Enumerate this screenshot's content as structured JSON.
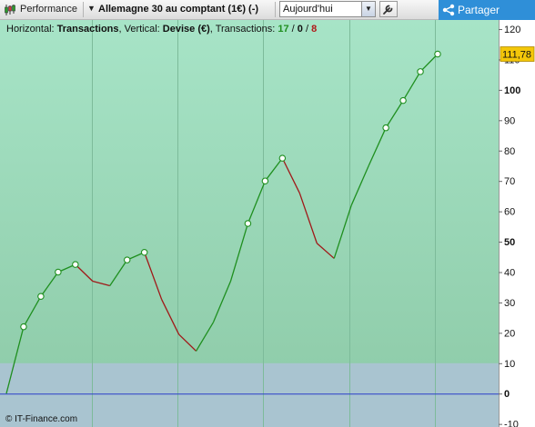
{
  "toolbar": {
    "performance_label": "Performance",
    "instrument_label": "Allemagne 30 au comptant (1€) (-)",
    "period_value": "Aujourd'hui",
    "share_label": "Partager",
    "icons": {
      "performance": "candlestick-chart-icon",
      "instrument_menu": "triangle-down-icon",
      "period": "chevron-down-icon",
      "settings": "wrench-icon",
      "share": "share-icon"
    }
  },
  "info": {
    "horizontal_prefix": "Horizontal: ",
    "horizontal_value": "Transactions",
    "vertical_prefix": ", Vertical: ",
    "vertical_value": "Devise (€)",
    "transactions_prefix": ", Transactions: ",
    "tx_win": "17",
    "tx_sep1": " / ",
    "tx_even": "0",
    "tx_sep2": " / ",
    "tx_loss": "8"
  },
  "credit": "© IT-Finance.com",
  "colors": {
    "profit_line": "#1f8f1f",
    "loss_line": "#a01818",
    "zero_line": "#2b3fc8",
    "bg_top": "#a7e4c7",
    "bg_bottom": "#8cc9a6",
    "below_band": "#a9c4d0",
    "last_value_badge": "#f3c70a",
    "tick_10_color": "#2e8b2e",
    "tick_neg10_color": "#cc2222"
  },
  "chart_data": {
    "type": "line",
    "xlabel": "Transactions",
    "ylabel": "Devise (€)",
    "ylim": [
      -11,
      123
    ],
    "x": [
      0,
      1,
      2,
      3,
      4,
      5,
      6,
      7,
      8,
      9,
      10,
      11,
      12,
      13,
      14,
      15,
      16,
      17,
      18,
      19,
      20,
      21,
      22,
      23,
      24,
      25
    ],
    "values": [
      0,
      22,
      32,
      40,
      42.5,
      37,
      35.5,
      44,
      46.5,
      31,
      19.5,
      14,
      23.5,
      37,
      56,
      70,
      77.5,
      66,
      49.5,
      44.5,
      62,
      75,
      87.5,
      96.5,
      106,
      111.78
    ],
    "markers": [
      1,
      2,
      3,
      4,
      7,
      8,
      14,
      15,
      16,
      22,
      23,
      24,
      25
    ],
    "y_ticks": [
      120,
      110,
      100,
      90,
      80,
      70,
      60,
      50,
      40,
      30,
      20,
      10,
      0,
      -10
    ],
    "y_tick_labels": [
      "120",
      "110",
      "100",
      "90",
      "80",
      "70",
      "60",
      "50",
      "40",
      "30",
      "20",
      "10",
      "0",
      "-10"
    ],
    "last_value_label": "111,78",
    "grid": true,
    "zero_line": 0,
    "lower_band_below": 10
  }
}
